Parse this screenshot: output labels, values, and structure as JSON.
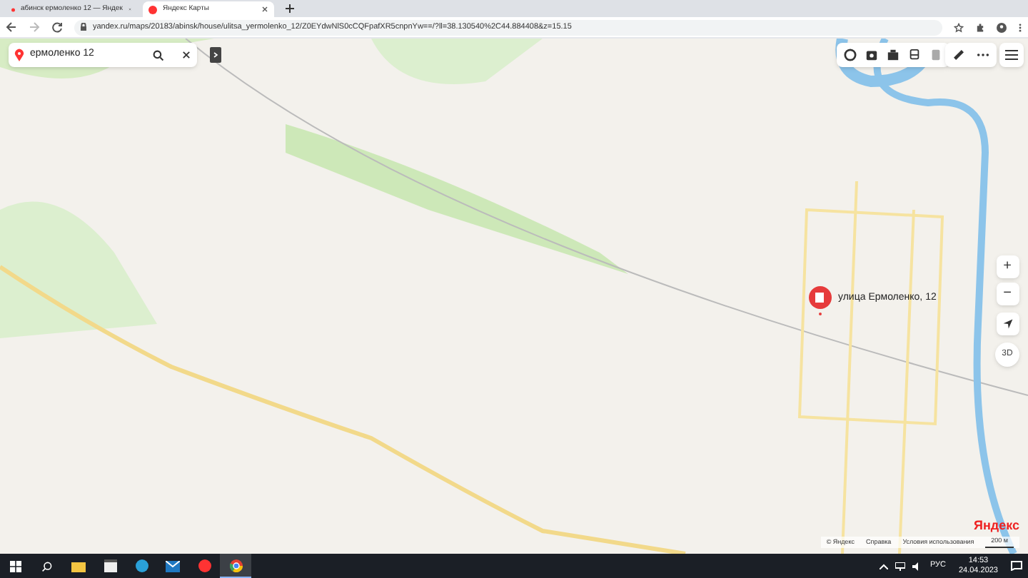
{
  "browser": {
    "tabs": [
      {
        "title": "абинск ермоленко 12 — Яндек",
        "selected": false
      },
      {
        "title": "Яндекс Карты",
        "selected": true
      }
    ],
    "address": "yandex.ru/maps/20183/abinsk/house/ulitsa_yermolenko_12/Z0EYdwNlS0cCQFpafXR5cnpnYw==/?ll=38.130540%2C44.884408&z=15.15"
  },
  "search": {
    "value": "ермоленко 12"
  },
  "map": {
    "pin_label": "улица Ермоленко, 12",
    "zoom_in": "+",
    "zoom_out": "−",
    "view_3d": "3D",
    "attribution": [
      "© Яндекс",
      "Справка",
      "Условия использования"
    ],
    "scale": "200 м",
    "logo": "Яндекс"
  },
  "taskbar": {
    "language": "РУС",
    "time": "14:53",
    "date": "24.04.2023"
  }
}
